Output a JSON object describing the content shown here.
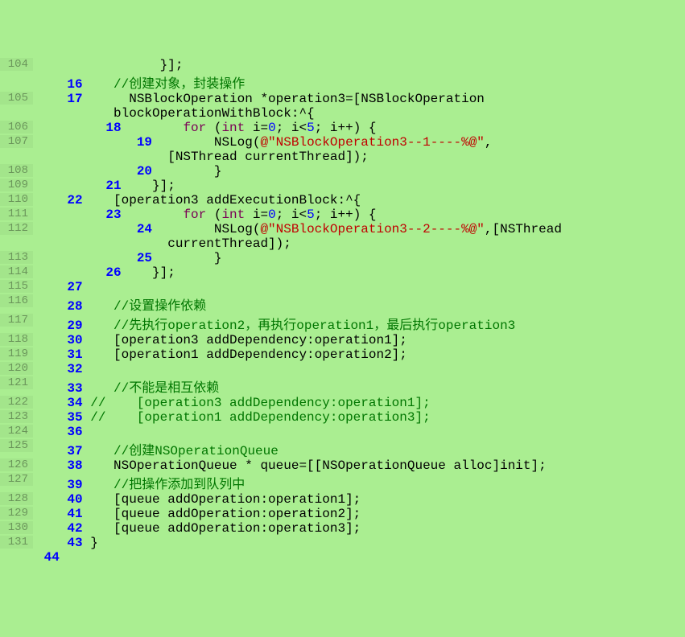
{
  "lines": [
    {
      "gutter": "104",
      "parts": [
        {
          "c": "plain",
          "t": "                }];"
        }
      ]
    },
    {
      "gutter": "",
      "parts": [
        {
          "c": "ln2",
          "t": "    16    "
        },
        {
          "c": "comment",
          "t": "//创建对象，封装操作"
        }
      ]
    },
    {
      "gutter": "105",
      "parts": [
        {
          "c": "ln2",
          "t": "    17    "
        },
        {
          "c": "plain",
          "t": "  NSBlockOperation *operation3=[NSBlockOperation"
        }
      ]
    },
    {
      "gutter": "",
      "parts": [
        {
          "c": "plain",
          "t": "          blockOperationWithBlock:^{"
        }
      ]
    },
    {
      "gutter": "106",
      "parts": [
        {
          "c": "ln2",
          "t": "         18        "
        },
        {
          "c": "kw",
          "t": "for"
        },
        {
          "c": "plain",
          "t": " ("
        },
        {
          "c": "kw",
          "t": "int"
        },
        {
          "c": "plain",
          "t": " i="
        },
        {
          "c": "num",
          "t": "0"
        },
        {
          "c": "plain",
          "t": "; i<"
        },
        {
          "c": "num",
          "t": "5"
        },
        {
          "c": "plain",
          "t": "; i++) {"
        }
      ]
    },
    {
      "gutter": "107",
      "parts": [
        {
          "c": "ln2",
          "t": "             19        "
        },
        {
          "c": "plain",
          "t": "NSLog("
        },
        {
          "c": "str",
          "t": "@\"NSBlockOperation3--1----%@\""
        },
        {
          "c": "plain",
          "t": ","
        }
      ]
    },
    {
      "gutter": "",
      "parts": [
        {
          "c": "plain",
          "t": "                 [NSThread currentThread]);"
        }
      ]
    },
    {
      "gutter": "108",
      "parts": [
        {
          "c": "ln2",
          "t": "             20        "
        },
        {
          "c": "plain",
          "t": "}"
        }
      ]
    },
    {
      "gutter": "109",
      "parts": [
        {
          "c": "ln2",
          "t": "         21    "
        },
        {
          "c": "plain",
          "t": "}];"
        }
      ]
    },
    {
      "gutter": "110",
      "parts": [
        {
          "c": "ln2",
          "t": "    22    "
        },
        {
          "c": "plain",
          "t": "[operation3 addExecutionBlock:^{"
        }
      ]
    },
    {
      "gutter": "111",
      "parts": [
        {
          "c": "ln2",
          "t": "         23        "
        },
        {
          "c": "kw",
          "t": "for"
        },
        {
          "c": "plain",
          "t": " ("
        },
        {
          "c": "kw",
          "t": "int"
        },
        {
          "c": "plain",
          "t": " i="
        },
        {
          "c": "num",
          "t": "0"
        },
        {
          "c": "plain",
          "t": "; i<"
        },
        {
          "c": "num",
          "t": "5"
        },
        {
          "c": "plain",
          "t": "; i++) {"
        }
      ]
    },
    {
      "gutter": "112",
      "parts": [
        {
          "c": "ln2",
          "t": "             24        "
        },
        {
          "c": "plain",
          "t": "NSLog("
        },
        {
          "c": "str",
          "t": "@\"NSBlockOperation3--2----%@\""
        },
        {
          "c": "plain",
          "t": ",[NSThread"
        }
      ]
    },
    {
      "gutter": "",
      "parts": [
        {
          "c": "plain",
          "t": "                 currentThread]);"
        }
      ]
    },
    {
      "gutter": "113",
      "parts": [
        {
          "c": "ln2",
          "t": "             25        "
        },
        {
          "c": "plain",
          "t": "}"
        }
      ]
    },
    {
      "gutter": "114",
      "parts": [
        {
          "c": "ln2",
          "t": "         26    "
        },
        {
          "c": "plain",
          "t": "}];"
        }
      ]
    },
    {
      "gutter": "115",
      "parts": [
        {
          "c": "ln2",
          "t": "    27    "
        }
      ]
    },
    {
      "gutter": "116",
      "parts": [
        {
          "c": "ln2",
          "t": "    28    "
        },
        {
          "c": "comment",
          "t": "//设置操作依赖"
        }
      ]
    },
    {
      "gutter": "117",
      "parts": [
        {
          "c": "ln2",
          "t": "    29    "
        },
        {
          "c": "comment",
          "t": "//先执行operation2，再执行operation1，最后执行operation3"
        }
      ]
    },
    {
      "gutter": "118",
      "parts": [
        {
          "c": "ln2",
          "t": "    30    "
        },
        {
          "c": "plain",
          "t": "[operation3 addDependency:operation1];"
        }
      ]
    },
    {
      "gutter": "119",
      "parts": [
        {
          "c": "ln2",
          "t": "    31    "
        },
        {
          "c": "plain",
          "t": "[operation1 addDependency:operation2];"
        }
      ]
    },
    {
      "gutter": "120",
      "parts": [
        {
          "c": "ln2",
          "t": "    32    "
        }
      ]
    },
    {
      "gutter": "121",
      "parts": [
        {
          "c": "ln2",
          "t": "    33    "
        },
        {
          "c": "comment",
          "t": "//不能是相互依赖"
        }
      ]
    },
    {
      "gutter": "122",
      "parts": [
        {
          "c": "ln2",
          "t": "    34"
        },
        {
          "c": "comment",
          "t": " //    [operation3 addDependency:operation1];"
        }
      ]
    },
    {
      "gutter": "123",
      "parts": [
        {
          "c": "ln2",
          "t": "    35"
        },
        {
          "c": "comment",
          "t": " //    [operation1 addDependency:operation3];"
        }
      ]
    },
    {
      "gutter": "124",
      "parts": [
        {
          "c": "ln2",
          "t": "    36    "
        }
      ]
    },
    {
      "gutter": "125",
      "parts": [
        {
          "c": "ln2",
          "t": "    37    "
        },
        {
          "c": "comment",
          "t": "//创建NSOperationQueue"
        }
      ]
    },
    {
      "gutter": "126",
      "parts": [
        {
          "c": "ln2",
          "t": "    38    "
        },
        {
          "c": "plain",
          "t": "NSOperationQueue * queue=[[NSOperationQueue alloc]init];"
        }
      ]
    },
    {
      "gutter": "127",
      "parts": [
        {
          "c": "ln2",
          "t": "    39    "
        },
        {
          "c": "comment",
          "t": "//把操作添加到队列中"
        }
      ]
    },
    {
      "gutter": "128",
      "parts": [
        {
          "c": "ln2",
          "t": "    40    "
        },
        {
          "c": "plain",
          "t": "[queue addOperation:operation1];"
        }
      ]
    },
    {
      "gutter": "129",
      "parts": [
        {
          "c": "ln2",
          "t": "    41    "
        },
        {
          "c": "plain",
          "t": "[queue addOperation:operation2];"
        }
      ]
    },
    {
      "gutter": "130",
      "parts": [
        {
          "c": "ln2",
          "t": "    42    "
        },
        {
          "c": "plain",
          "t": "[queue addOperation:operation3];"
        }
      ]
    },
    {
      "gutter": "131",
      "parts": [
        {
          "c": "ln2",
          "t": "    43"
        },
        {
          "c": "plain",
          "t": " }"
        }
      ]
    },
    {
      "gutter": "",
      "parts": [
        {
          "c": "ln2",
          "t": " 44"
        }
      ]
    }
  ]
}
